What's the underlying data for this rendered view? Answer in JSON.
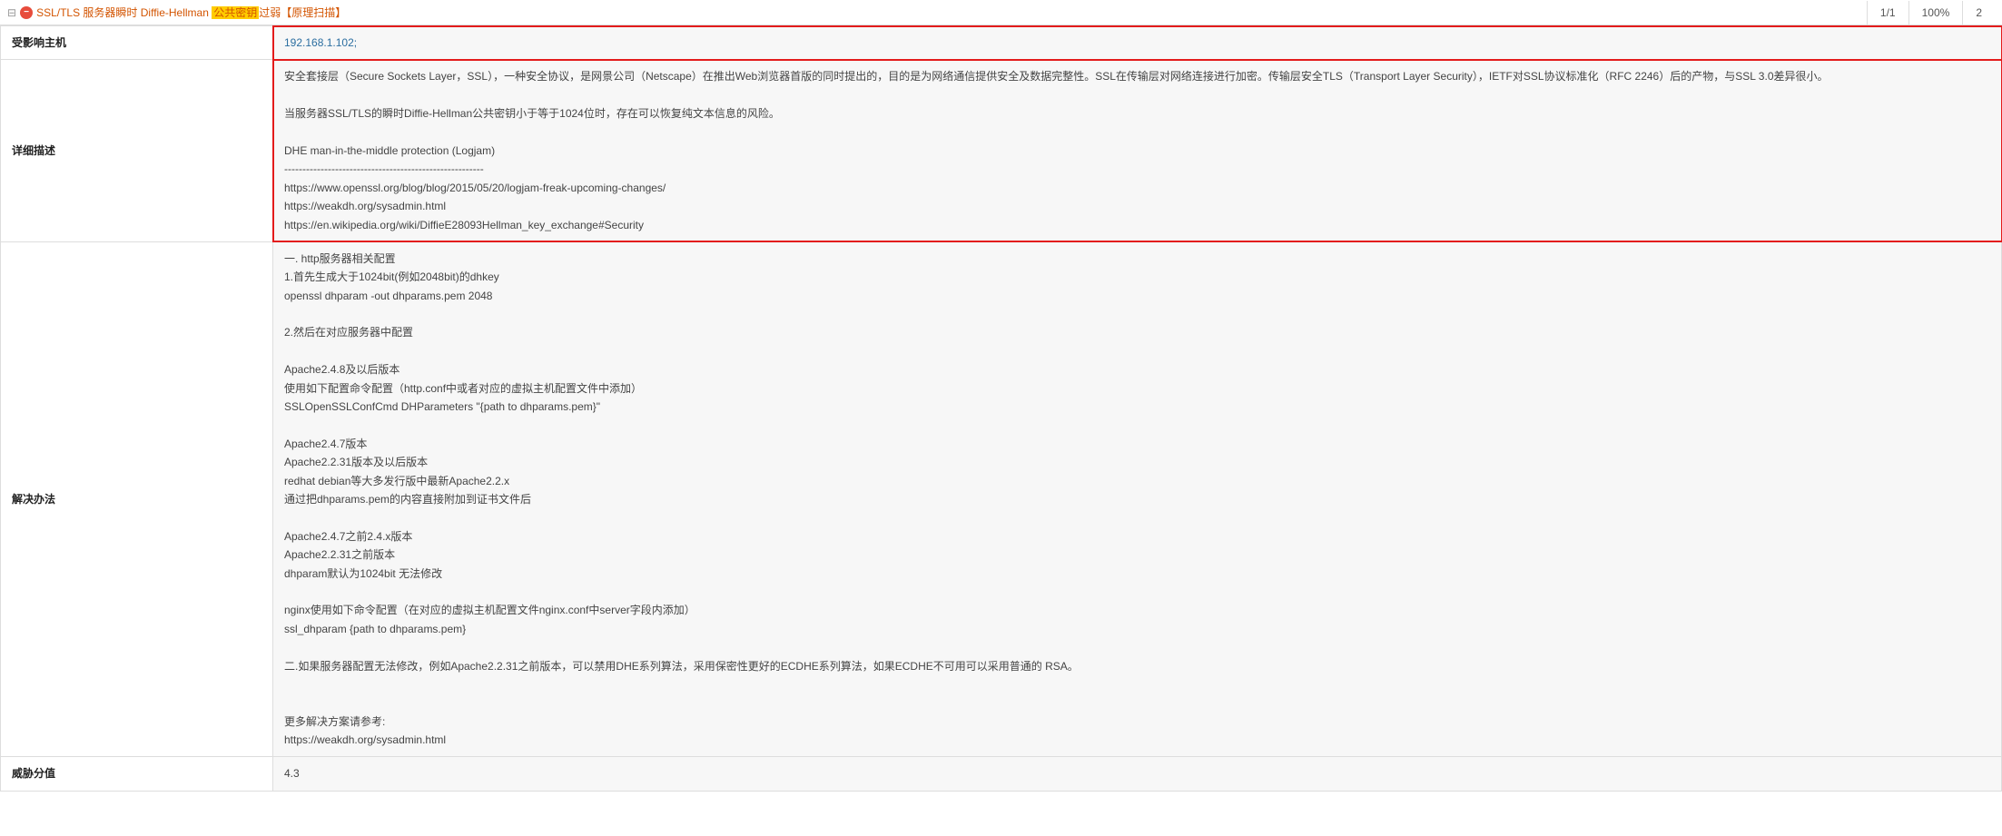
{
  "header": {
    "title_prefix": "SSL/TLS 服务器瞬时 Diffie-Hellman ",
    "title_highlight": "公共密钥",
    "title_suffix": "过弱【原理扫描】",
    "counter": "1/1",
    "percent": "100%",
    "count": "2"
  },
  "rows": {
    "affected_host": {
      "label": "受影响主机",
      "value": "192.168.1.102;"
    },
    "description": {
      "label": "详细描述",
      "value": "安全套接层（Secure Sockets Layer，SSL），一种安全协议，是网景公司（Netscape）在推出Web浏览器首版的同时提出的，目的是为网络通信提供安全及数据完整性。SSL在传输层对网络连接进行加密。传输层安全TLS（Transport Layer Security），IETF对SSL协议标准化（RFC 2246）后的产物，与SSL 3.0差异很小。\n\n当服务器SSL/TLS的瞬时Diffie-Hellman公共密钥小于等于1024位时，存在可以恢复纯文本信息的风险。\n\nDHE man-in-the-middle protection (Logjam)\n-------------------------------------------------------\nhttps://www.openssl.org/blog/blog/2015/05/20/logjam-freak-upcoming-changes/\nhttps://weakdh.org/sysadmin.html\nhttps://en.wikipedia.org/wiki/DiffieE28093Hellman_key_exchange#Security"
    },
    "solution": {
      "label": "解决办法",
      "value": "一. http服务器相关配置\n1.首先生成大于1024bit(例如2048bit)的dhkey\nopenssl dhparam -out dhparams.pem 2048\n\n2.然后在对应服务器中配置\n\nApache2.4.8及以后版本\n使用如下配置命令配置（http.conf中或者对应的虚拟主机配置文件中添加）\nSSLOpenSSLConfCmd DHParameters \"{path to dhparams.pem}\"\n\nApache2.4.7版本\nApache2.2.31版本及以后版本\nredhat debian等大多发行版中最新Apache2.2.x\n通过把dhparams.pem的内容直接附加到证书文件后\n\nApache2.4.7之前2.4.x版本\nApache2.2.31之前版本\ndhparam默认为1024bit 无法修改\n\nnginx使用如下命令配置（在对应的虚拟主机配置文件nginx.conf中server字段内添加）\nssl_dhparam {path to dhparams.pem}\n\n二.如果服务器配置无法修改，例如Apache2.2.31之前版本，可以禁用DHE系列算法，采用保密性更好的ECDHE系列算法，如果ECDHE不可用可以采用普通的 RSA。\n\n\n更多解决方案请参考:\nhttps://weakdh.org/sysadmin.html"
    },
    "threat": {
      "label": "威胁分值",
      "value": "4.3"
    }
  }
}
